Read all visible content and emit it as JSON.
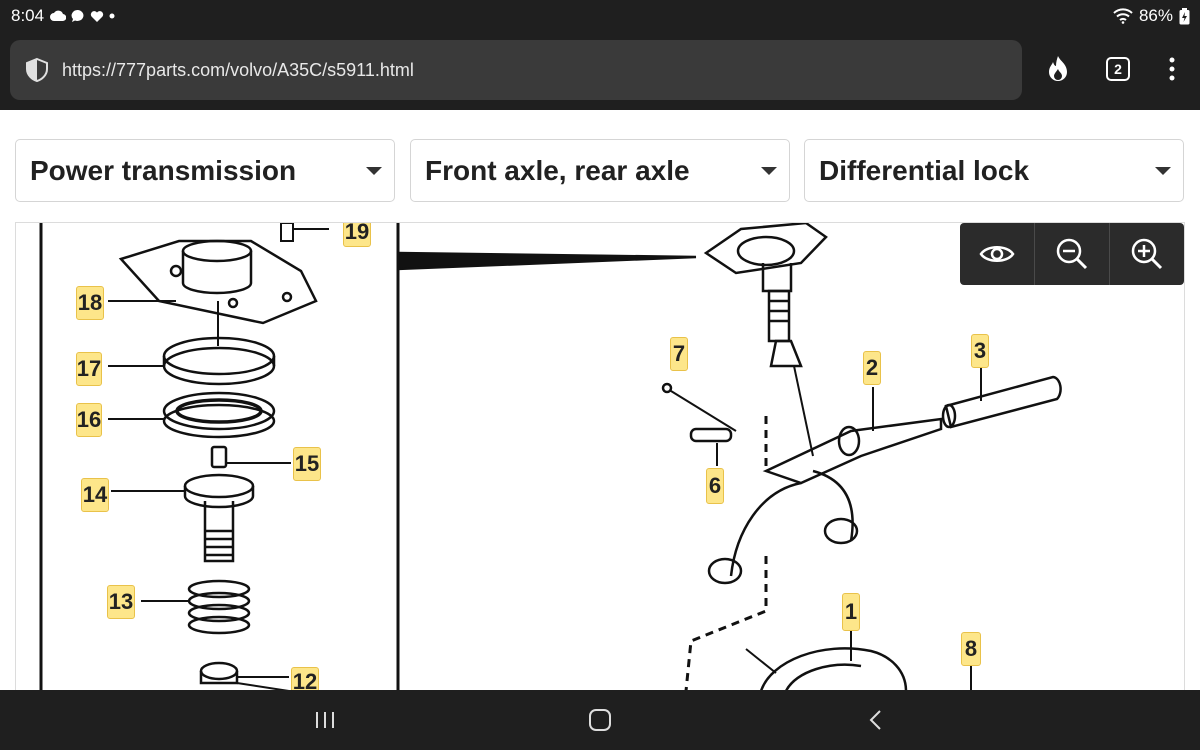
{
  "status": {
    "time": "8:04",
    "battery": "86%"
  },
  "browser": {
    "url": "https://777parts.com/volvo/A35C/s5911.html",
    "tab_count": "2"
  },
  "filters": {
    "category": "Power transmission",
    "subcategory": "Front axle, rear axle",
    "component": "Differential lock"
  },
  "diagram": {
    "labels": [
      {
        "id": "19",
        "text": "19"
      },
      {
        "id": "18",
        "text": "18"
      },
      {
        "id": "17",
        "text": "17"
      },
      {
        "id": "16",
        "text": "16"
      },
      {
        "id": "15",
        "text": "15"
      },
      {
        "id": "14",
        "text": "14"
      },
      {
        "id": "13",
        "text": "13"
      },
      {
        "id": "12",
        "text": "12"
      },
      {
        "id": "7",
        "text": "7"
      },
      {
        "id": "2",
        "text": "2"
      },
      {
        "id": "3",
        "text": "3"
      },
      {
        "id": "6",
        "text": "6"
      },
      {
        "id": "1",
        "text": "1"
      },
      {
        "id": "8",
        "text": "8"
      }
    ]
  },
  "icons": {
    "shield": "shield-icon",
    "flame": "flame-icon",
    "menu": "more-vert-icon",
    "eye": "eye-icon",
    "zoom_out": "zoom-out-icon",
    "zoom_in": "zoom-in-icon",
    "recents": "recents-icon",
    "home": "home-icon",
    "back": "back-icon"
  }
}
